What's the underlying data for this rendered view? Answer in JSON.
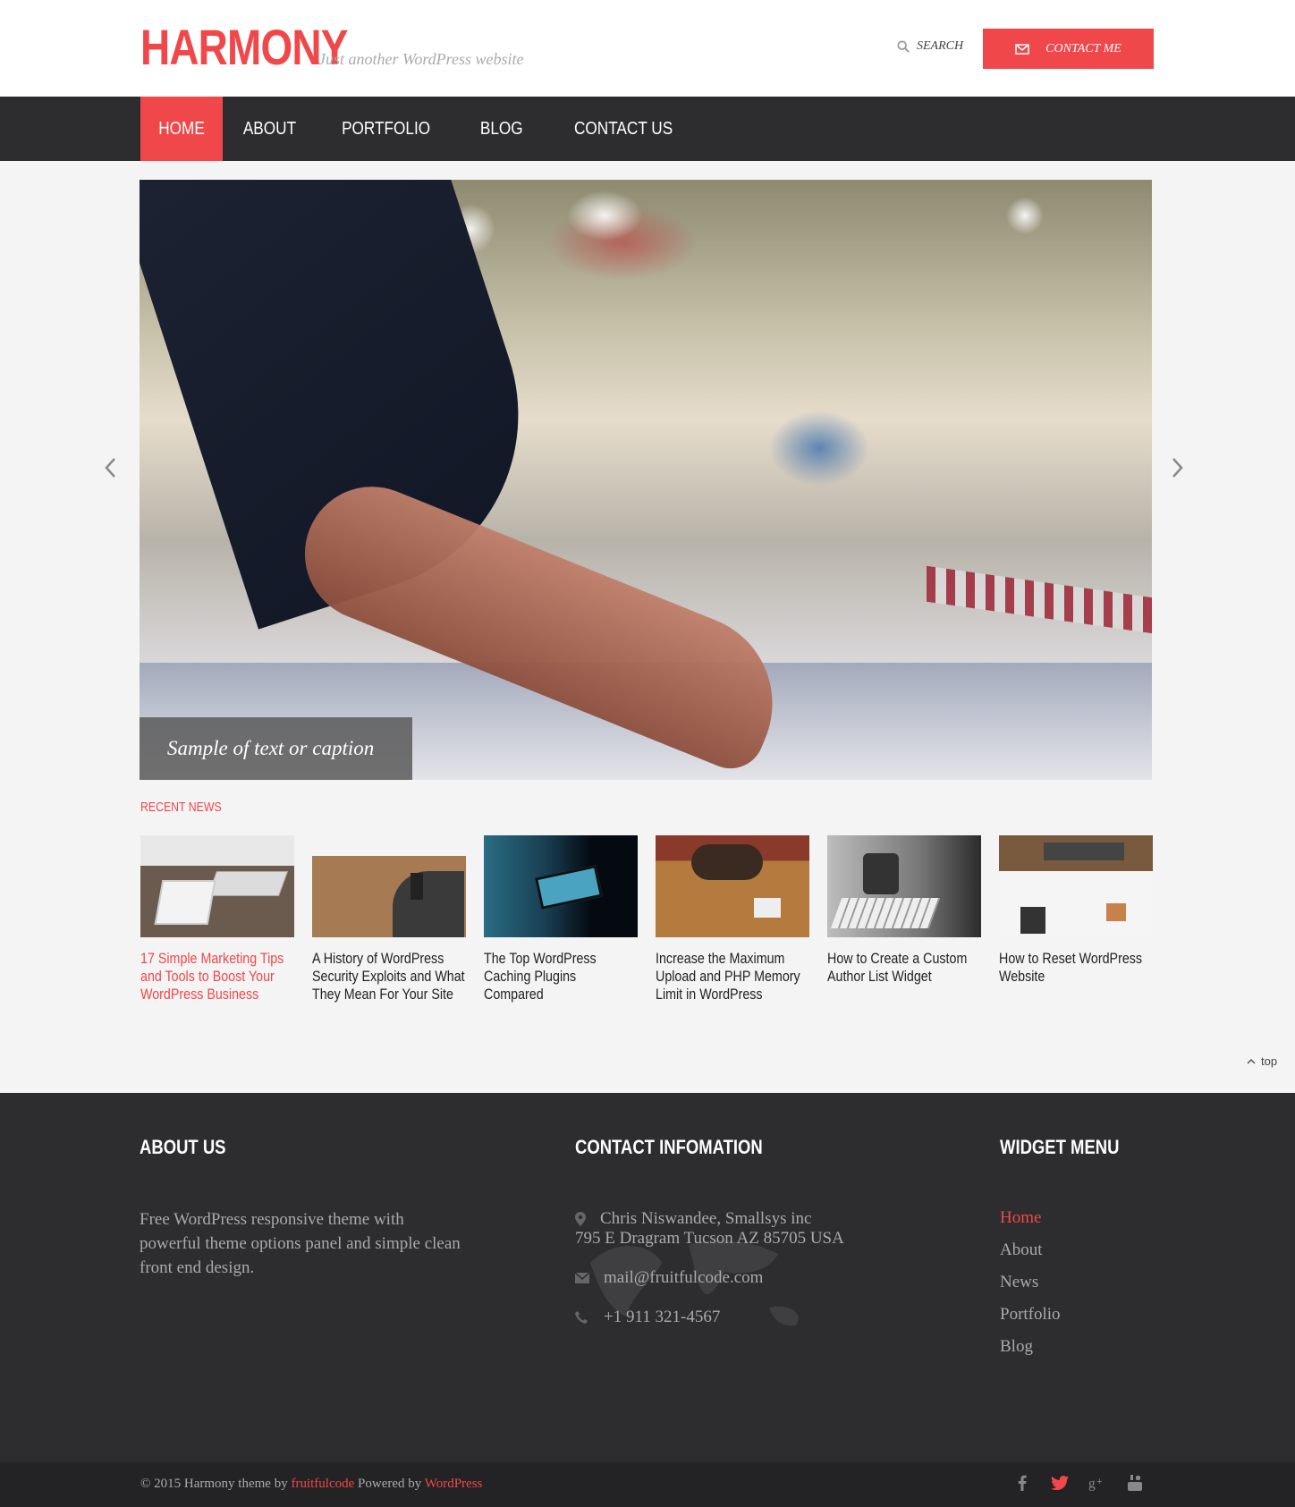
{
  "header": {
    "logo": "HARMONY",
    "tagline": "Just another WordPress website",
    "search_label": "SEARCH",
    "contact_button": "CONTACT ME"
  },
  "nav": {
    "items": [
      {
        "label": "HOME",
        "active": true
      },
      {
        "label": "ABOUT"
      },
      {
        "label": "PORTFOLIO"
      },
      {
        "label": "BLOG"
      },
      {
        "label": "CONTACT US"
      }
    ]
  },
  "slider": {
    "caption": "Sample of text or caption"
  },
  "recent_news": {
    "title": "RECENT NEWS",
    "items": [
      {
        "title": "17 Simple Marketing Tips and Tools to Boost Your WordPress Business",
        "highlighted": true
      },
      {
        "title": "A History of WordPress Security Exploits and What They Mean For Your Site"
      },
      {
        "title": "The Top WordPress Caching Plugins Compared"
      },
      {
        "title": "Increase the Maximum Upload and PHP Memory Limit in WordPress"
      },
      {
        "title": "How to Create a Custom Author List Widget"
      },
      {
        "title": "How to Reset WordPress Website"
      }
    ]
  },
  "to_top": "top",
  "footer": {
    "about": {
      "heading": "ABOUT US",
      "text": "Free WordPress responsive theme with powerful theme options panel and simple clean front end design."
    },
    "contact": {
      "heading": "CONTACT INFOMATION",
      "address_line1": "Chris Niswandee, Smallsys inc",
      "address_line2": "795 E Dragram Tucson AZ 85705 USA",
      "email": "mail@fruitfulcode.com",
      "phone": "+1 911 321-4567"
    },
    "widget_menu": {
      "heading": "WIDGET MENU",
      "items": [
        "Home",
        "About",
        "News",
        "Portfolio",
        "Blog"
      ]
    }
  },
  "bottom": {
    "copyright_prefix": "© 2015 Harmony theme by",
    "author_link": "fruitfulcode",
    "powered_text": "Powered by",
    "powered_link": "WordPress",
    "social": [
      "facebook-icon",
      "twitter-icon",
      "google-plus-icon",
      "youtube-icon"
    ]
  },
  "colors": {
    "accent": "#f0474a",
    "dark": "#2d2d2f"
  }
}
